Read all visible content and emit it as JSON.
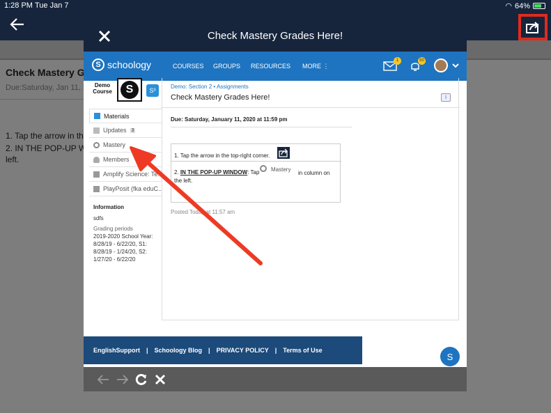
{
  "status_bar": {
    "time": "1:28 PM",
    "date": "Tue Jan 7",
    "battery": "64%"
  },
  "background_page": {
    "title": "Check Mastery Grades Here!",
    "due_label": "Due:",
    "due_partial": "Saturday, Jan 11, 2",
    "step1": "1. Tap the arrow in th",
    "step2": "2. IN THE POP-UP W",
    "step2_cont": "left."
  },
  "modal": {
    "title": "Check Mastery Grades Here!",
    "nav": {
      "logo": "schoology",
      "items": [
        "COURSES",
        "GROUPS",
        "RESOURCES",
        "MORE ⋮"
      ],
      "mail_count": "1",
      "notif_count": "50"
    },
    "course": {
      "name": "Demo Course",
      "logo_letter": "S"
    },
    "sidebar": {
      "items": [
        {
          "label": "Materials",
          "icon": "materials-icon"
        },
        {
          "label": "Updates",
          "count": "3",
          "icon": "updates-icon"
        },
        {
          "label": "Mastery",
          "icon": "mastery-icon"
        },
        {
          "label": "Members",
          "icon": "members-icon"
        },
        {
          "label": "Amplify Science: Te...",
          "icon": "app-icon"
        },
        {
          "label": "PlayPosit (fka eduC...",
          "icon": "app-icon"
        }
      ],
      "info_heading": "Information",
      "info_value": "sdfs",
      "grading_heading": "Grading periods",
      "grading_value": "2019-2020 School Year: 8/28/19 - 6/22/20, S1: 8/28/19 - 1/24/20, S2: 1/27/20 - 6/22/20"
    },
    "main": {
      "breadcrumb": "Demo: Section 2 • Assignments",
      "title": "Check Mastery Grades Here!",
      "due": "Due: Saturday, January 11, 2020 at 11:59 pm",
      "step1": "1. Tap the arrow in the top-right corner.",
      "step2_underline": "IN THE POP-UP WINDOW",
      "step2_prefix": "2. ",
      "step2_mid": ": Tap",
      "step2_mastery": "Mastery",
      "step2_end": "in column on",
      "step2_left": "the left.",
      "posted": "Posted Today at 11:57 am"
    },
    "footer": {
      "links": [
        "EnglishSupport",
        "Schoology Blog",
        "PRIVACY POLICY",
        "Terms of Use"
      ],
      "chat_letter": "S"
    }
  },
  "colors": {
    "nav_blue": "#1e74c0",
    "header_navy": "#16253c",
    "highlight_red": "#e02a1c"
  }
}
